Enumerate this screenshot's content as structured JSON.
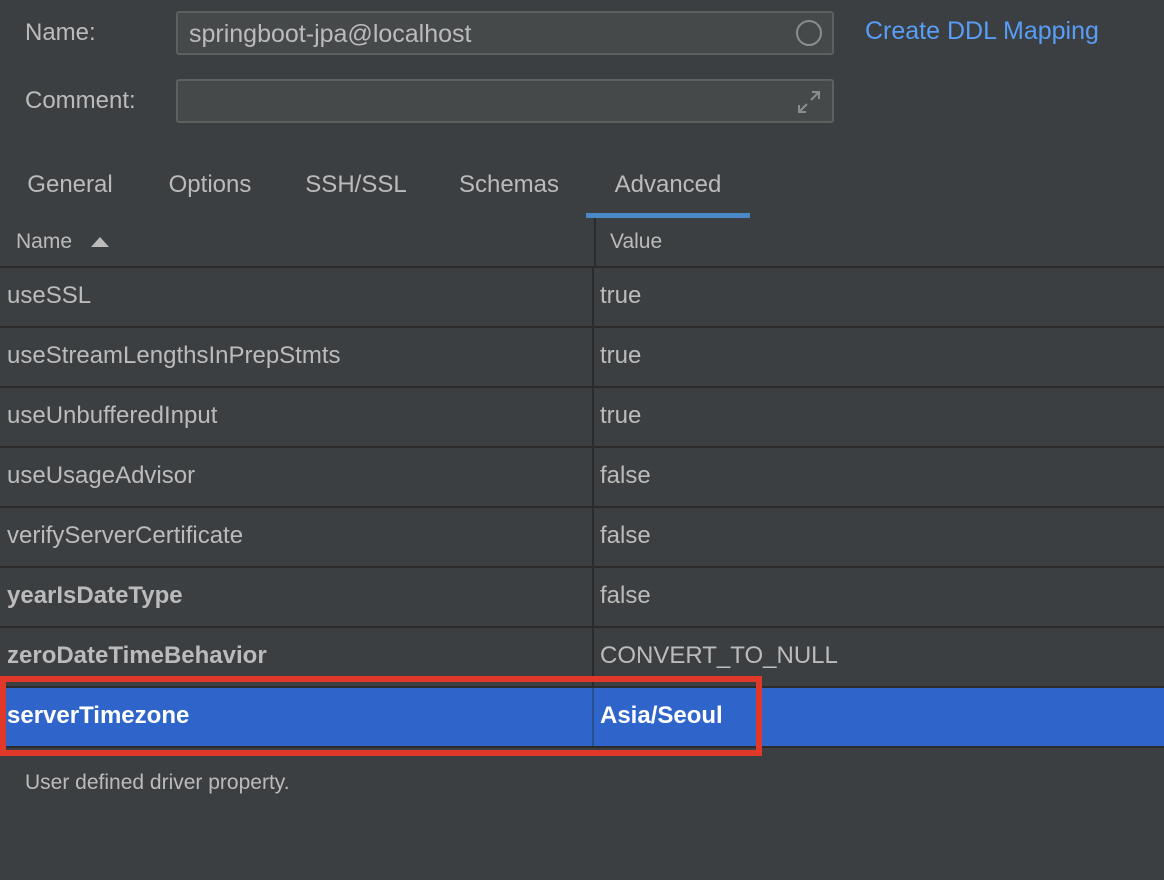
{
  "form": {
    "name_label": "Name:",
    "name_value": "springboot-jpa@localhost",
    "comment_label": "Comment:",
    "comment_value": "",
    "ddl_link": "Create DDL Mapping"
  },
  "tabs": [
    {
      "label": "General",
      "active": false
    },
    {
      "label": "Options",
      "active": false
    },
    {
      "label": "SSH/SSL",
      "active": false
    },
    {
      "label": "Schemas",
      "active": false
    },
    {
      "label": "Advanced",
      "active": true
    }
  ],
  "table": {
    "columns": [
      "Name",
      "Value"
    ],
    "sort": "ascending",
    "rows": [
      {
        "name": "useSSL",
        "value": "true",
        "bold": false,
        "selected": false
      },
      {
        "name": "useStreamLengthsInPrepStmts",
        "value": "true",
        "bold": false,
        "selected": false
      },
      {
        "name": "useUnbufferedInput",
        "value": "true",
        "bold": false,
        "selected": false
      },
      {
        "name": "useUsageAdvisor",
        "value": "false",
        "bold": false,
        "selected": false
      },
      {
        "name": "verifyServerCertificate",
        "value": "false",
        "bold": false,
        "selected": false
      },
      {
        "name": "yearIsDateType",
        "value": "false",
        "bold": true,
        "selected": false
      },
      {
        "name": "zeroDateTimeBehavior",
        "value": "CONVERT_TO_NULL",
        "bold": true,
        "selected": false
      },
      {
        "name": "serverTimezone",
        "value": "Asia/Seoul",
        "bold": true,
        "selected": true
      }
    ]
  },
  "description": "User defined driver property.",
  "colors": {
    "background": "#3c3f41",
    "accent_link": "#589df6",
    "selection": "#2f65ca",
    "highlight_box": "#e0392a",
    "tab_underline": "#4a88c7"
  },
  "icons": {
    "name_field": "circle-icon",
    "comment_field": "expand-icon",
    "sort": "sort-ascending-icon"
  }
}
